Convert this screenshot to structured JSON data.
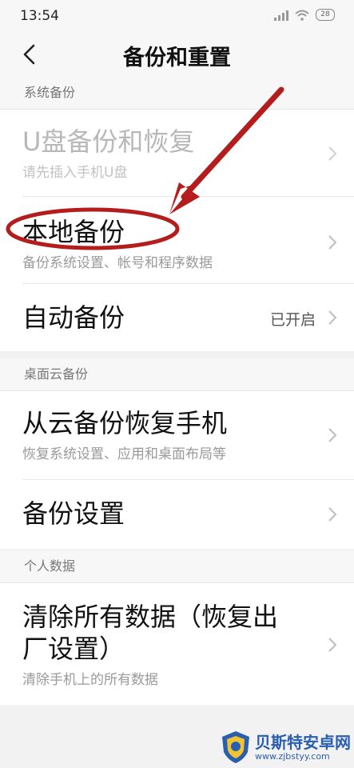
{
  "status_bar": {
    "time": "13:54",
    "battery": "28"
  },
  "title_bar": {
    "title": "备份和重置"
  },
  "sections": [
    {
      "header": "系统备份",
      "rows": [
        {
          "title": "U盘备份和恢复",
          "subtitle": "请先插入手机U盘"
        },
        {
          "title": "本地备份",
          "subtitle": "备份系统设置、帐号和程序数据"
        },
        {
          "title": "自动备份",
          "value": "已开启"
        }
      ]
    },
    {
      "header": "桌面云备份",
      "rows": [
        {
          "title": "从云备份恢复手机",
          "subtitle": "恢复系统设置、应用和桌面布局等"
        },
        {
          "title": "备份设置"
        }
      ]
    },
    {
      "header": "个人数据",
      "rows": [
        {
          "title": "清除所有数据（恢复出厂设置）",
          "subtitle": "清除手机上的所有数据"
        }
      ]
    }
  ],
  "annotation": {
    "color": "#b51d1d"
  },
  "watermark": {
    "title": "贝斯特安卓网",
    "url": "www.zjbstyy.com"
  }
}
